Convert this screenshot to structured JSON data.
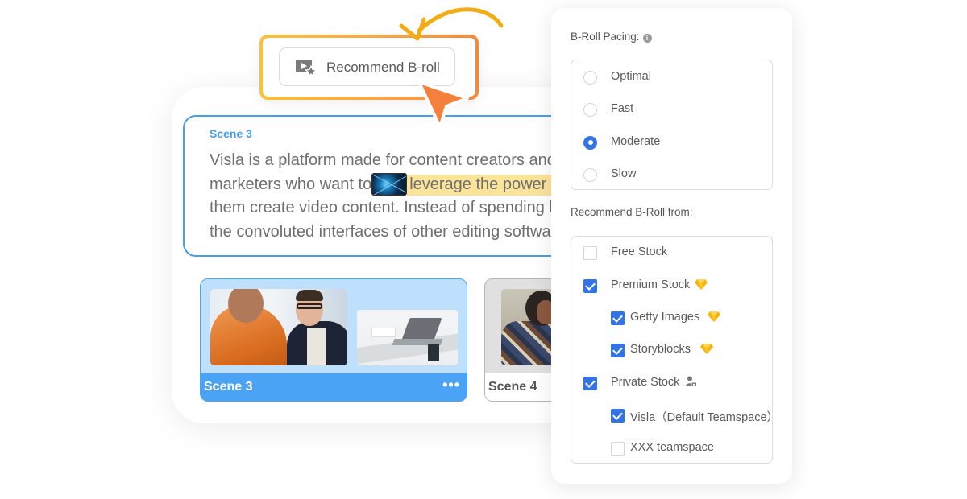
{
  "recommend_button": {
    "label": "Recommend B-roll",
    "icon": "video-star-icon"
  },
  "script": {
    "scene_title": "Scene 3",
    "lines": [
      "Visla is a platform made for content creators and",
      "marketers who want to",
      "leverage the power o",
      "them create video content. Instead of spending h",
      "the convoluted interfaces of other editing softwar"
    ],
    "highlight_color": "#fbe39a"
  },
  "scenes": [
    {
      "label": "Scene 3",
      "selected": true,
      "more": "•••"
    },
    {
      "label": "Scene 4",
      "selected": false
    }
  ],
  "panel": {
    "pacing_title": "B-Roll Pacing:",
    "pacing_info_icon": "i",
    "pacing_options": [
      {
        "label": "Optimal",
        "checked": false
      },
      {
        "label": "Fast",
        "checked": false
      },
      {
        "label": "Moderate",
        "checked": true
      },
      {
        "label": "Slow",
        "checked": false
      }
    ],
    "sources_title": "Recommend B-Roll from:",
    "sources": [
      {
        "label": "Free Stock",
        "checked": false,
        "level": 0,
        "badge": ""
      },
      {
        "label": "Premium Stock",
        "checked": true,
        "level": 0,
        "badge": "gem"
      },
      {
        "label": "Getty Images",
        "checked": true,
        "level": 1,
        "badge": "gem"
      },
      {
        "label": "Storyblocks",
        "checked": true,
        "level": 1,
        "badge": "gem"
      },
      {
        "label": "Private Stock",
        "checked": true,
        "level": 0,
        "badge": "private-user"
      },
      {
        "label": "Visla（Default Teamspace）",
        "checked": true,
        "level": 1,
        "badge": ""
      },
      {
        "label": "XXX teamspace",
        "checked": false,
        "level": 1,
        "badge": ""
      }
    ]
  },
  "colors": {
    "accent_blue": "#4a9ee8",
    "checkbox_blue": "#3373e6",
    "scene_selected": "#4aa3f5",
    "highlight_orange": "#f7a64a",
    "cursor_orange": "#f5803c",
    "gem_gold": "#f5b400"
  }
}
